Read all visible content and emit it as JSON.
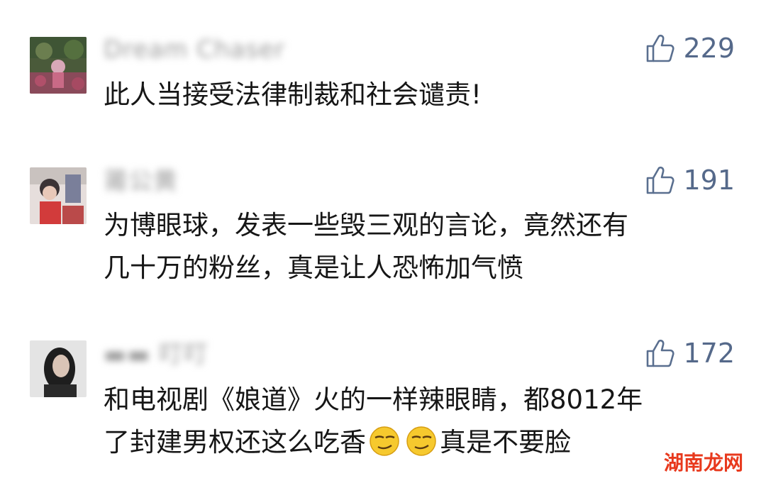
{
  "comments": [
    {
      "nickname": "Dream Chaser",
      "likes": "229",
      "lines": [
        "此人当接受法律制裁和社会谴责!"
      ]
    },
    {
      "nickname": "莆公黄",
      "likes": "191",
      "lines": [
        "为博眼球，发表一些毁三观的言论，竟然还有",
        "几十万的粉丝，真是让人恐怖加气愤"
      ]
    },
    {
      "nickname": "▬▬ 叮叮",
      "likes": "172",
      "line1": "和电视剧《娘道》火的一样辣眼睛，都8012年",
      "line2_before": "了封建男权还这么吃香",
      "line2_after": "真是不要脸"
    }
  ],
  "icons": {
    "like": "thumbs-up-icon",
    "emoji": "smirk-emoji-icon"
  },
  "colors": {
    "like_accent": "#55698a",
    "nickname": "#9a9a9a",
    "watermark": "#e8391d"
  },
  "watermark": "湖南龙网"
}
